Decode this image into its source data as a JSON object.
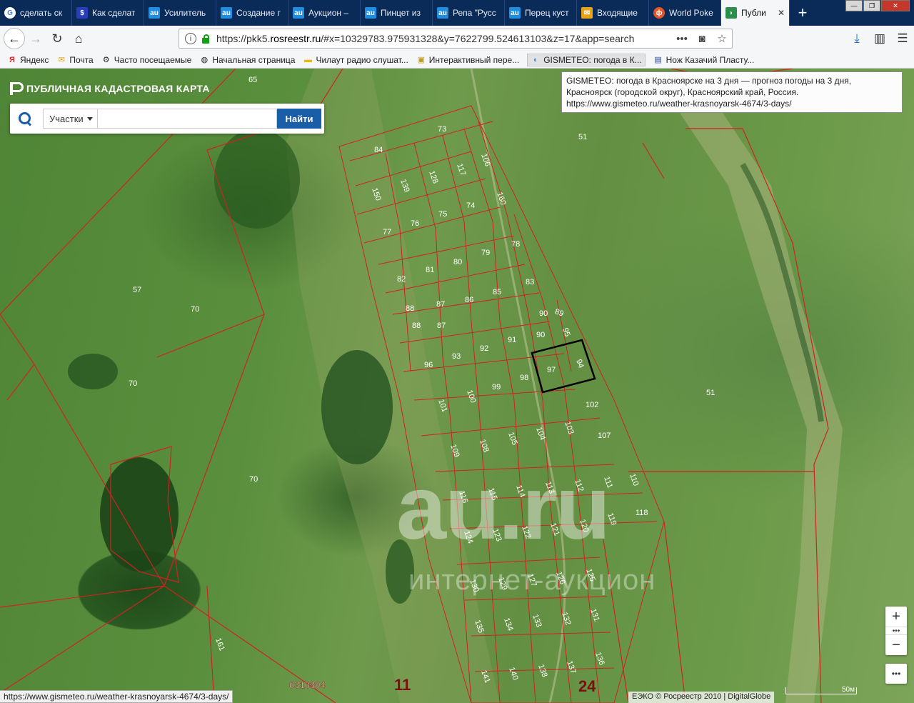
{
  "tabs": [
    {
      "label": "сделать ск",
      "icon": "google-icon",
      "color": "#ffffff"
    },
    {
      "label": "Как сделат",
      "icon": "dollar-icon",
      "color": "#2a3dbb"
    },
    {
      "label": "Усилитель",
      "icon": "au-icon",
      "color": "#1f8de0"
    },
    {
      "label": "Создание г",
      "icon": "au-icon",
      "color": "#1f8de0"
    },
    {
      "label": "Аукцион –",
      "icon": "au-icon",
      "color": "#1f8de0"
    },
    {
      "label": "Пинцет из",
      "icon": "au-icon",
      "color": "#1f8de0"
    },
    {
      "label": "Репа \"Русс",
      "icon": "au-icon",
      "color": "#1f8de0"
    },
    {
      "label": "Перец куст",
      "icon": "au-icon",
      "color": "#1f8de0"
    },
    {
      "label": "Входящие",
      "icon": "mail-icon",
      "color": "#e8a317"
    },
    {
      "label": "World Poke",
      "icon": "poker-icon",
      "color": "#e2562a"
    },
    {
      "label": "Публи",
      "icon": "rosreestr-icon",
      "color": "#2a8f4a"
    }
  ],
  "nav": {
    "url_prefix": "https://pkk5.",
    "url_host": "rosreestr.ru",
    "url_rest": "/#x=10329783.975931328&y=7622799.524613103&z=17&app=search"
  },
  "bookmarks": [
    {
      "label": "Яндекс",
      "icon": "yandex-icon"
    },
    {
      "label": "Почта",
      "icon": "mail-icon"
    },
    {
      "label": "Часто посещаемые",
      "icon": "gear-icon"
    },
    {
      "label": "Начальная страница",
      "icon": "globe-icon"
    },
    {
      "label": "Чилаут радио слушат...",
      "icon": "folder-icon"
    },
    {
      "label": "Интерактивный пере...",
      "icon": "bookmark-icon"
    },
    {
      "label": "GISMETEO: погода в К...",
      "icon": "gismeteo-icon"
    },
    {
      "label": "Нож Казачий Пласту...",
      "icon": "flag-icon"
    }
  ],
  "panel": {
    "title": "ПУБЛИЧНАЯ КАДАСТРОВАЯ КАРТА",
    "type_label": "Участки",
    "search_value": "",
    "find_label": "Найти"
  },
  "tooltip": {
    "line1": "GISMETEO: погода в Красноярске на 3 дня — прогноз погоды на 3 дня, Красноярск (городской округ), Красноярский край, Россия.",
    "line2": "https://www.gismeteo.ru/weather-krasnoyarsk-4674/3-days/"
  },
  "watermark": {
    "logo": "au.ru",
    "tagline": "интернет-аукцион"
  },
  "map": {
    "parcel_labels": [
      "65",
      "73",
      "84",
      "106",
      "117",
      "128",
      "139",
      "150",
      "51",
      "74",
      "75",
      "76",
      "77",
      "160",
      "78",
      "79",
      "80",
      "81",
      "82",
      "83",
      "57",
      "70",
      "85",
      "86",
      "87",
      "88",
      "89",
      "90",
      "91",
      "92",
      "93",
      "94",
      "95",
      "96",
      "97",
      "98",
      "99",
      "100",
      "101",
      "102",
      "103",
      "104",
      "105",
      "107",
      "108",
      "109",
      "110",
      "111",
      "112",
      "113",
      "114",
      "115",
      "116",
      "118",
      "119",
      "120",
      "121",
      "122",
      "123",
      "124",
      "125",
      "126",
      "127",
      "129",
      "130",
      "131",
      "132",
      "133",
      "134",
      "135",
      "136",
      "137",
      "138",
      "140",
      "141",
      "161"
    ],
    "area_codes": [
      "0310304",
      "11",
      "24"
    ]
  },
  "status_url": "https://www.gismeteo.ru/weather-krasnoyarsk-4674/3-days/",
  "copyright": "ЕЭКО © Росреестр 2010 | DigitalGlobe",
  "scale": "50м",
  "zoom": {
    "in": "+",
    "out": "−",
    "more": "•••"
  }
}
